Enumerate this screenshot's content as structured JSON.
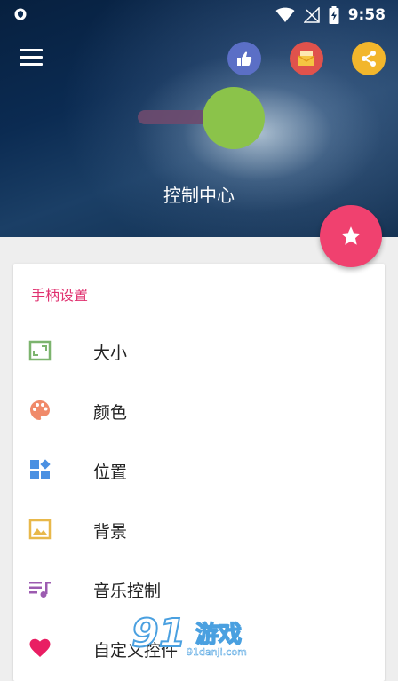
{
  "status": {
    "time": "9:58"
  },
  "header": {
    "title": "控制中心"
  },
  "section": {
    "title": "手柄设置"
  },
  "items": [
    {
      "label": "大小",
      "icon": "resize-icon",
      "color": "#7cb46e"
    },
    {
      "label": "颜色",
      "icon": "palette-icon",
      "color": "#f08a6a"
    },
    {
      "label": "位置",
      "icon": "dashboard-icon",
      "color": "#4a90e2"
    },
    {
      "label": "背景",
      "icon": "image-icon",
      "color": "#e8b84a"
    },
    {
      "label": "音乐控制",
      "icon": "playlist-icon",
      "color": "#9c5bb0"
    },
    {
      "label": "自定义控件",
      "icon": "heart-icon",
      "color": "#e91e63"
    }
  ],
  "watermark": {
    "num": "91",
    "text": "游戏",
    "url": "91danji.com"
  }
}
